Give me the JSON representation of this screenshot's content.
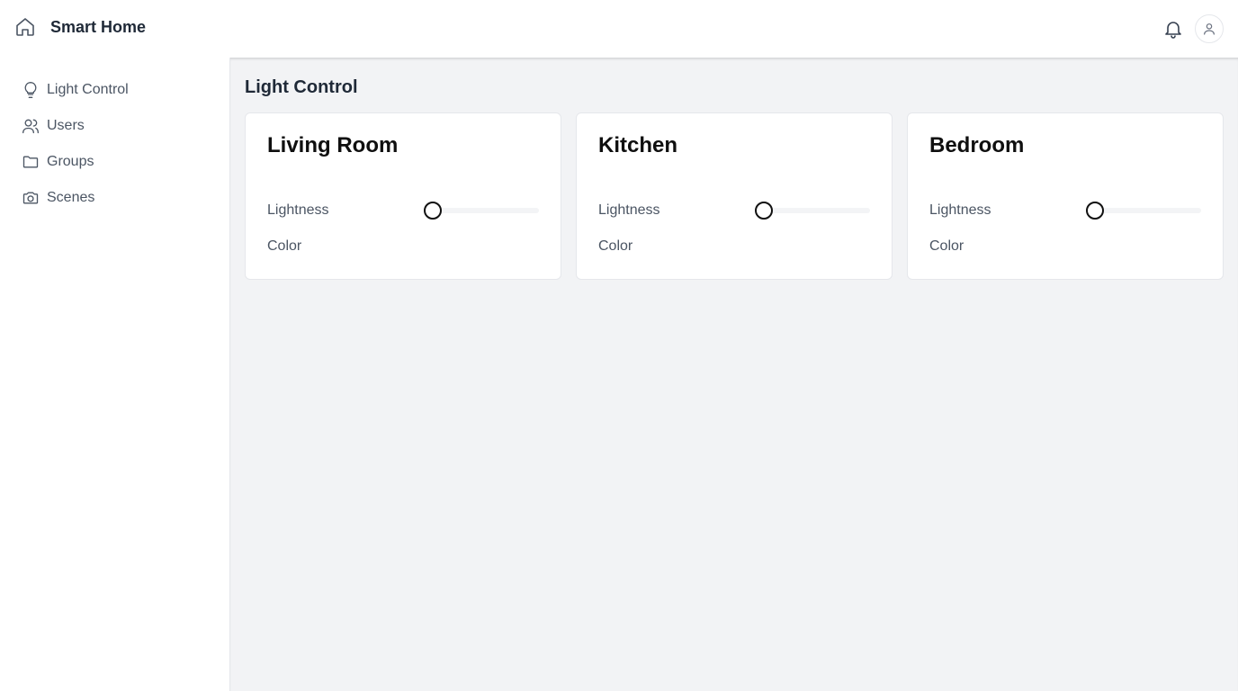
{
  "app": {
    "title": "Smart Home"
  },
  "header": {
    "icons": [
      "home-icon",
      "bell-icon",
      "user-icon"
    ]
  },
  "sidebar": {
    "items": [
      {
        "label": "Light Control",
        "icon": "lightbulb-icon"
      },
      {
        "label": "Users",
        "icon": "users-icon"
      },
      {
        "label": "Groups",
        "icon": "folder-icon"
      },
      {
        "label": "Scenes",
        "icon": "camera-icon"
      }
    ]
  },
  "main": {
    "title": "Light Control",
    "cards": [
      {
        "name": "Living Room",
        "lightness_label": "Lightness",
        "lightness_value": 0,
        "color_label": "Color"
      },
      {
        "name": "Kitchen",
        "lightness_label": "Lightness",
        "lightness_value": 0,
        "color_label": "Color"
      },
      {
        "name": "Bedroom",
        "lightness_label": "Lightness",
        "lightness_value": 0,
        "color_label": "Color"
      }
    ]
  },
  "colors": {
    "main_background": "#f2f3f5",
    "card_background": "#ffffff",
    "text_primary": "#1f2937",
    "text_secondary": "#4b5563",
    "slider_track": "#f3f4f6",
    "slider_thumb_border": "#111111"
  }
}
